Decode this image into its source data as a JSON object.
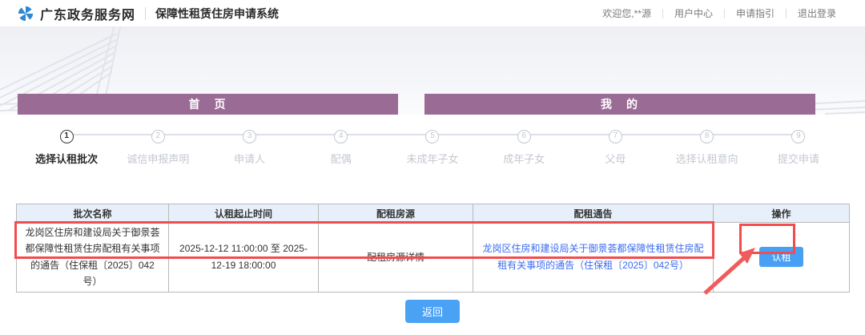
{
  "header": {
    "site_name": "广东政务服务网",
    "system_name": "保障性租赁住房申请系统",
    "welcome": "欢迎您,**源",
    "links": {
      "user_center": "用户中心",
      "guide": "申请指引",
      "logout": "退出登录"
    }
  },
  "section_bars": {
    "home": "首　页",
    "mine": "我　的"
  },
  "stepper": {
    "steps": [
      {
        "num": "1",
        "label": "选择认租批次"
      },
      {
        "num": "2",
        "label": "诚信申报声明"
      },
      {
        "num": "3",
        "label": "申请人"
      },
      {
        "num": "4",
        "label": "配偶"
      },
      {
        "num": "5",
        "label": "未成年子女"
      },
      {
        "num": "6",
        "label": "成年子女"
      },
      {
        "num": "7",
        "label": "父母"
      },
      {
        "num": "8",
        "label": "选择认租意向"
      },
      {
        "num": "9",
        "label": "提交申请"
      }
    ],
    "active_step": 1
  },
  "table": {
    "headers": [
      "批次名称",
      "认租起止时间",
      "配租房源",
      "配租通告",
      "操作"
    ],
    "rows": [
      {
        "batch_name": "龙岗区住房和建设局关于御景荟都保障性租赁住房配租有关事项的通告（住保租〔2025〕042号）",
        "time_range": "2025-12-12 11:00:00 至 2025-12-19 18:00:00",
        "house_link": "配租房源详情",
        "notice_link": "龙岗区住房和建设局关于御景荟都保障性租赁住房配租有关事项的通告（住保租〔2025〕042号）",
        "action_label": "认租"
      }
    ]
  },
  "buttons": {
    "back": "返回"
  },
  "colors": {
    "bar_purple": "#9a6b95",
    "header_bg": "#e7effa",
    "link_blue": "#3b6cf0",
    "button_blue": "#47a0f3",
    "annotation_red": "#f24c4c"
  }
}
